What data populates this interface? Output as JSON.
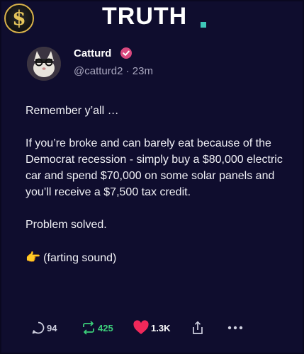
{
  "app": {
    "brand": "TRUTH",
    "brand_dot_color": "#3ec7b9",
    "logo_symbol": "$",
    "logo_icon": "dollar-sign-logo-icon"
  },
  "post": {
    "author_name": "Catturd",
    "verified_icon": "verified-badge-icon",
    "handle": "@catturd2",
    "separator": "·",
    "time": "23m",
    "paragraphs": [
      "Remember y’all …",
      "If you’re broke and can barely eat because of the Democrat recession - simply buy a $80,000 electric car and spend $70,000 on some solar panels and you’ll receive a $7,500 tax credit.",
      "Problem solved."
    ],
    "last_line_icon": "👉",
    "last_line_text": "(farting sound)"
  },
  "actions": {
    "reply_count": "94",
    "retruth_count": "425",
    "like_count": "1.3K",
    "reply_color": "#cfd0e0",
    "retruth_color": "#3ccf7a",
    "like_color": "#f0285a"
  }
}
